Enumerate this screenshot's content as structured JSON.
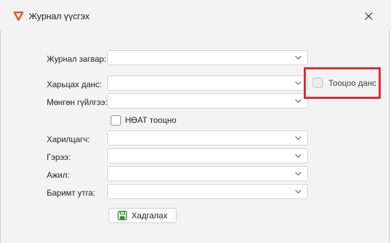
{
  "window": {
    "title": "Журнал үүсгэх"
  },
  "form": {
    "fields": [
      {
        "label": "Журнал загвар:",
        "value": ""
      },
      {
        "label": "Харьцах данс:",
        "value": ""
      },
      {
        "label": "Мөнгөн гүйлгээ:",
        "value": ""
      },
      {
        "label": "Харилцагч:",
        "value": ""
      },
      {
        "label": "Гэрээ:",
        "value": ""
      },
      {
        "label": "Ажил:",
        "value": ""
      },
      {
        "label": "Баримт утга:",
        "value": ""
      }
    ],
    "vat_checkbox": {
      "label": "НӨАТ тооцно",
      "checked": false
    },
    "calc_account": {
      "label": "Тооцоо данс",
      "checked": false,
      "enabled": false
    },
    "save_button": {
      "label": "Хадгалах"
    }
  },
  "colors": {
    "highlight": "#e3242b",
    "app_icon": "#e8532f",
    "save_icon": "#2e8b3a"
  },
  "icons": {
    "app": "app-logo-icon",
    "close": "close-icon",
    "dropdown": "chevron-down-icon",
    "save": "floppy-disk-icon"
  }
}
